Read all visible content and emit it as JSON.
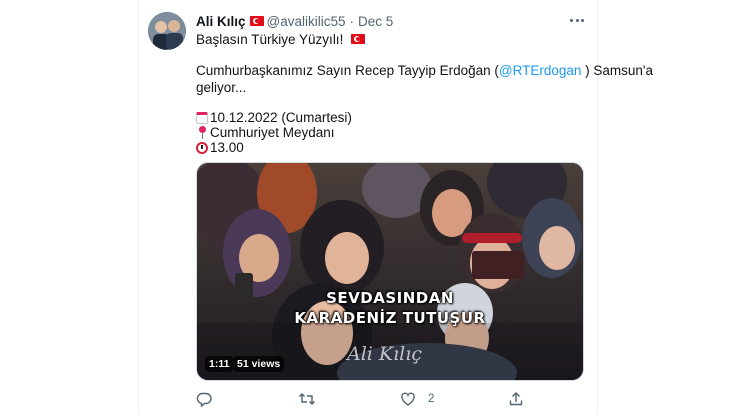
{
  "tweet": {
    "author_name": "Ali Kılıç",
    "handle": "@avalikilic55",
    "separator": "·",
    "date": "Dec 5",
    "line1": "Başlasın Türkiye Yüzyılı!",
    "line2_before": "Cumhurbaşkanımız Sayın Recep Tayyip Erdoğan (",
    "mention": "@RTErdogan",
    "line2_after": " ) Samsun'a",
    "line3": "geliyor...",
    "event_date": "10.12.2022 (Cumartesi)",
    "event_place": "Cumhuriyet Meydanı",
    "event_time": "13.00"
  },
  "media": {
    "overlay_line1": "SEVDASINDAN",
    "overlay_line2": "KARADENİZ TUTUŞUR",
    "signature": "Ali Kılıç",
    "duration": "1:11",
    "views": "51 views"
  },
  "actions": {
    "likes": "2"
  },
  "icons": {
    "flag": "turkey-flag-icon",
    "more": "more-icon",
    "calendar": "calendar-icon",
    "pin": "pin-icon",
    "clock": "clock-icon",
    "reply": "reply-icon",
    "retweet": "retweet-icon",
    "like": "like-icon",
    "share": "share-icon"
  },
  "colors": {
    "link": "#1d9bf0",
    "secondary_text": "#536471",
    "flag_red": "#e30a17"
  }
}
